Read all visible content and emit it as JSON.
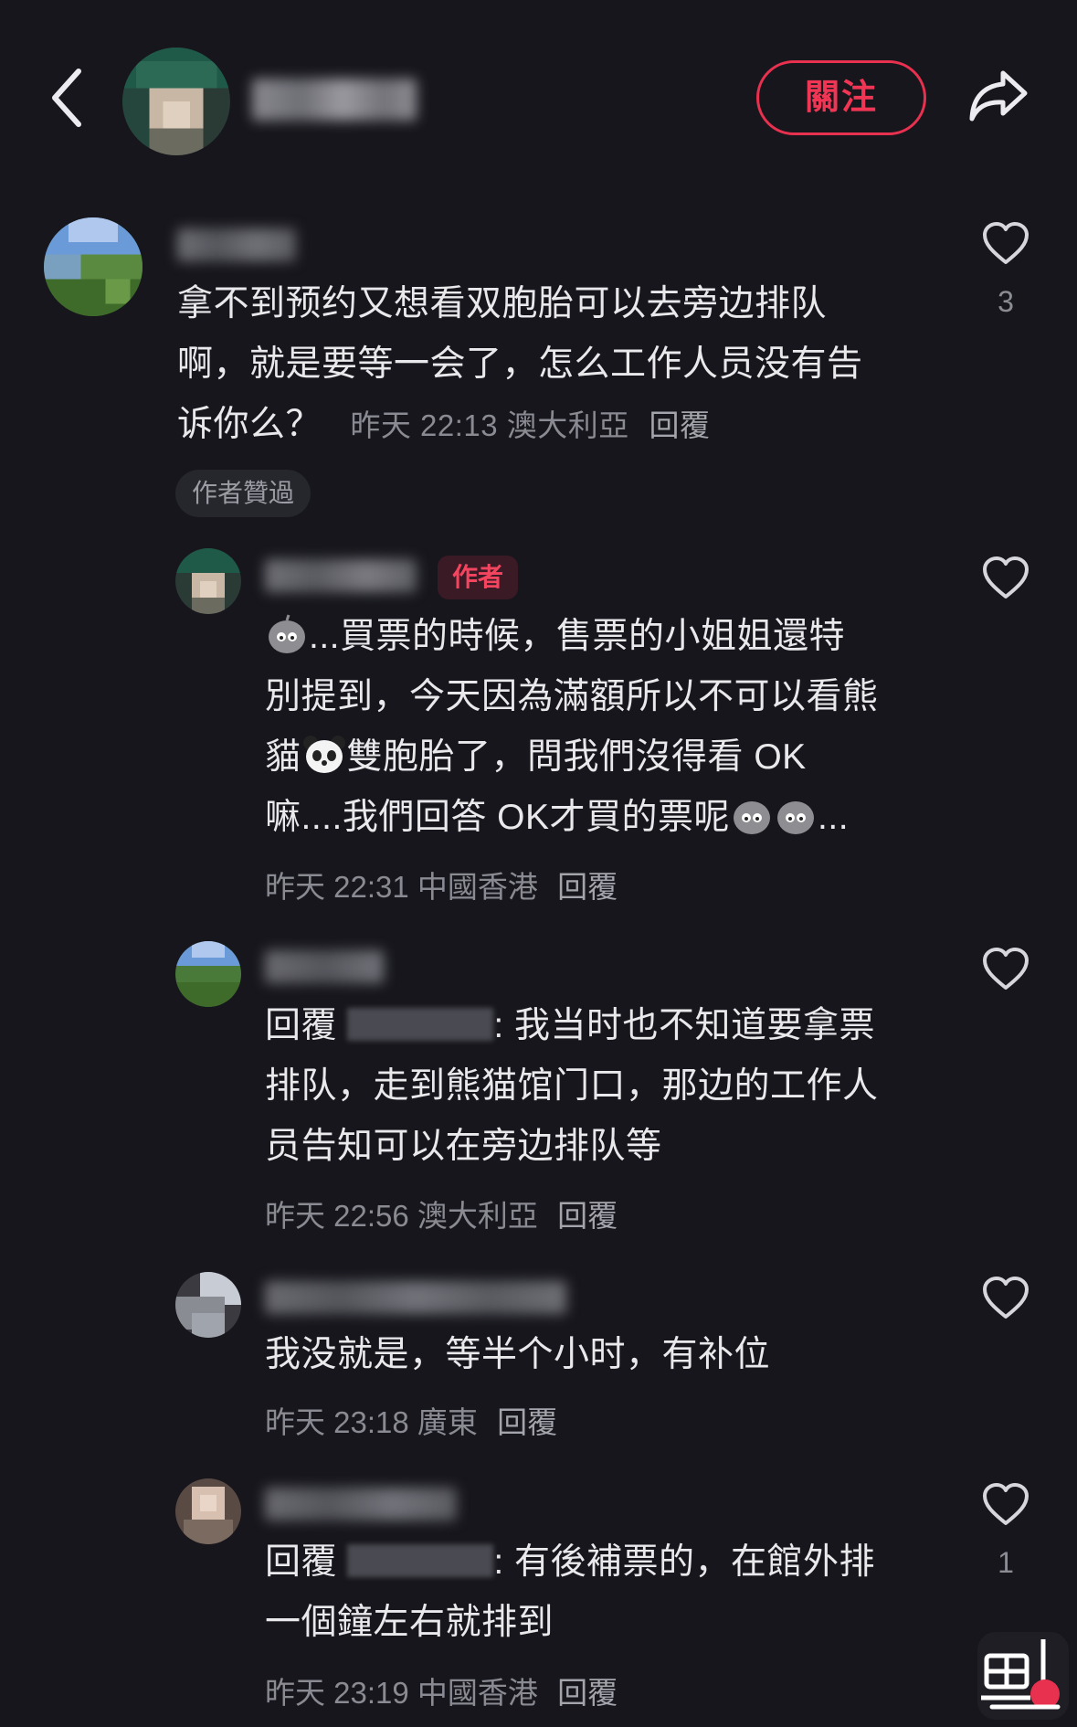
{
  "header": {
    "back_icon": "chevron-left-icon",
    "follow_label": "關注",
    "share_icon": "share-arrow-icon"
  },
  "comment": {
    "text_line1": "拿不到预约又想看双胞胎可以去旁边排队",
    "text_line2": "啊，就是要等一会了，怎么工作人员没有告",
    "text_line3": "诉你么？",
    "time": "昨天 22:13",
    "location": "澳大利亞",
    "reply_label": "回覆",
    "likes": "3",
    "author_liked_tag": "作者贊過"
  },
  "replies": [
    {
      "author_tag": "作者",
      "line1": "...買票的時候，售票的小姐姐還特",
      "line2": "別提到，今天因為滿額所以不可以看熊",
      "line3a": "貓",
      "line3b": "雙胞胎了，問我們沒得看 OK",
      "line4a": "嘛....我們回答 OK才買的票呢",
      "line4b": "...",
      "time": "昨天 22:31",
      "location": "中國香港",
      "reply_label": "回覆"
    },
    {
      "reply_prefix": "回覆",
      "line1_rest": ": 我当时也不知道要拿票",
      "line2": "排队，走到熊猫馆门口，那边的工作人",
      "line3": "员告知可以在旁边排队等",
      "time": "昨天 22:56",
      "location": "澳大利亞",
      "reply_label": "回覆"
    },
    {
      "line1": "我没就是，等半个小时，有补位",
      "time": "昨天 23:18",
      "location": "廣東",
      "reply_label": "回覆"
    },
    {
      "reply_prefix": "回覆",
      "line1_rest": ": 有後補票的，在館外排",
      "line2": "一個鐘左右就排到",
      "time": "昨天 23:19",
      "location": "中國香港",
      "reply_label": "回覆",
      "likes": "1"
    }
  ],
  "colors": {
    "background": "#16161c",
    "accent": "#f03654",
    "meta": "#8a8a93"
  }
}
